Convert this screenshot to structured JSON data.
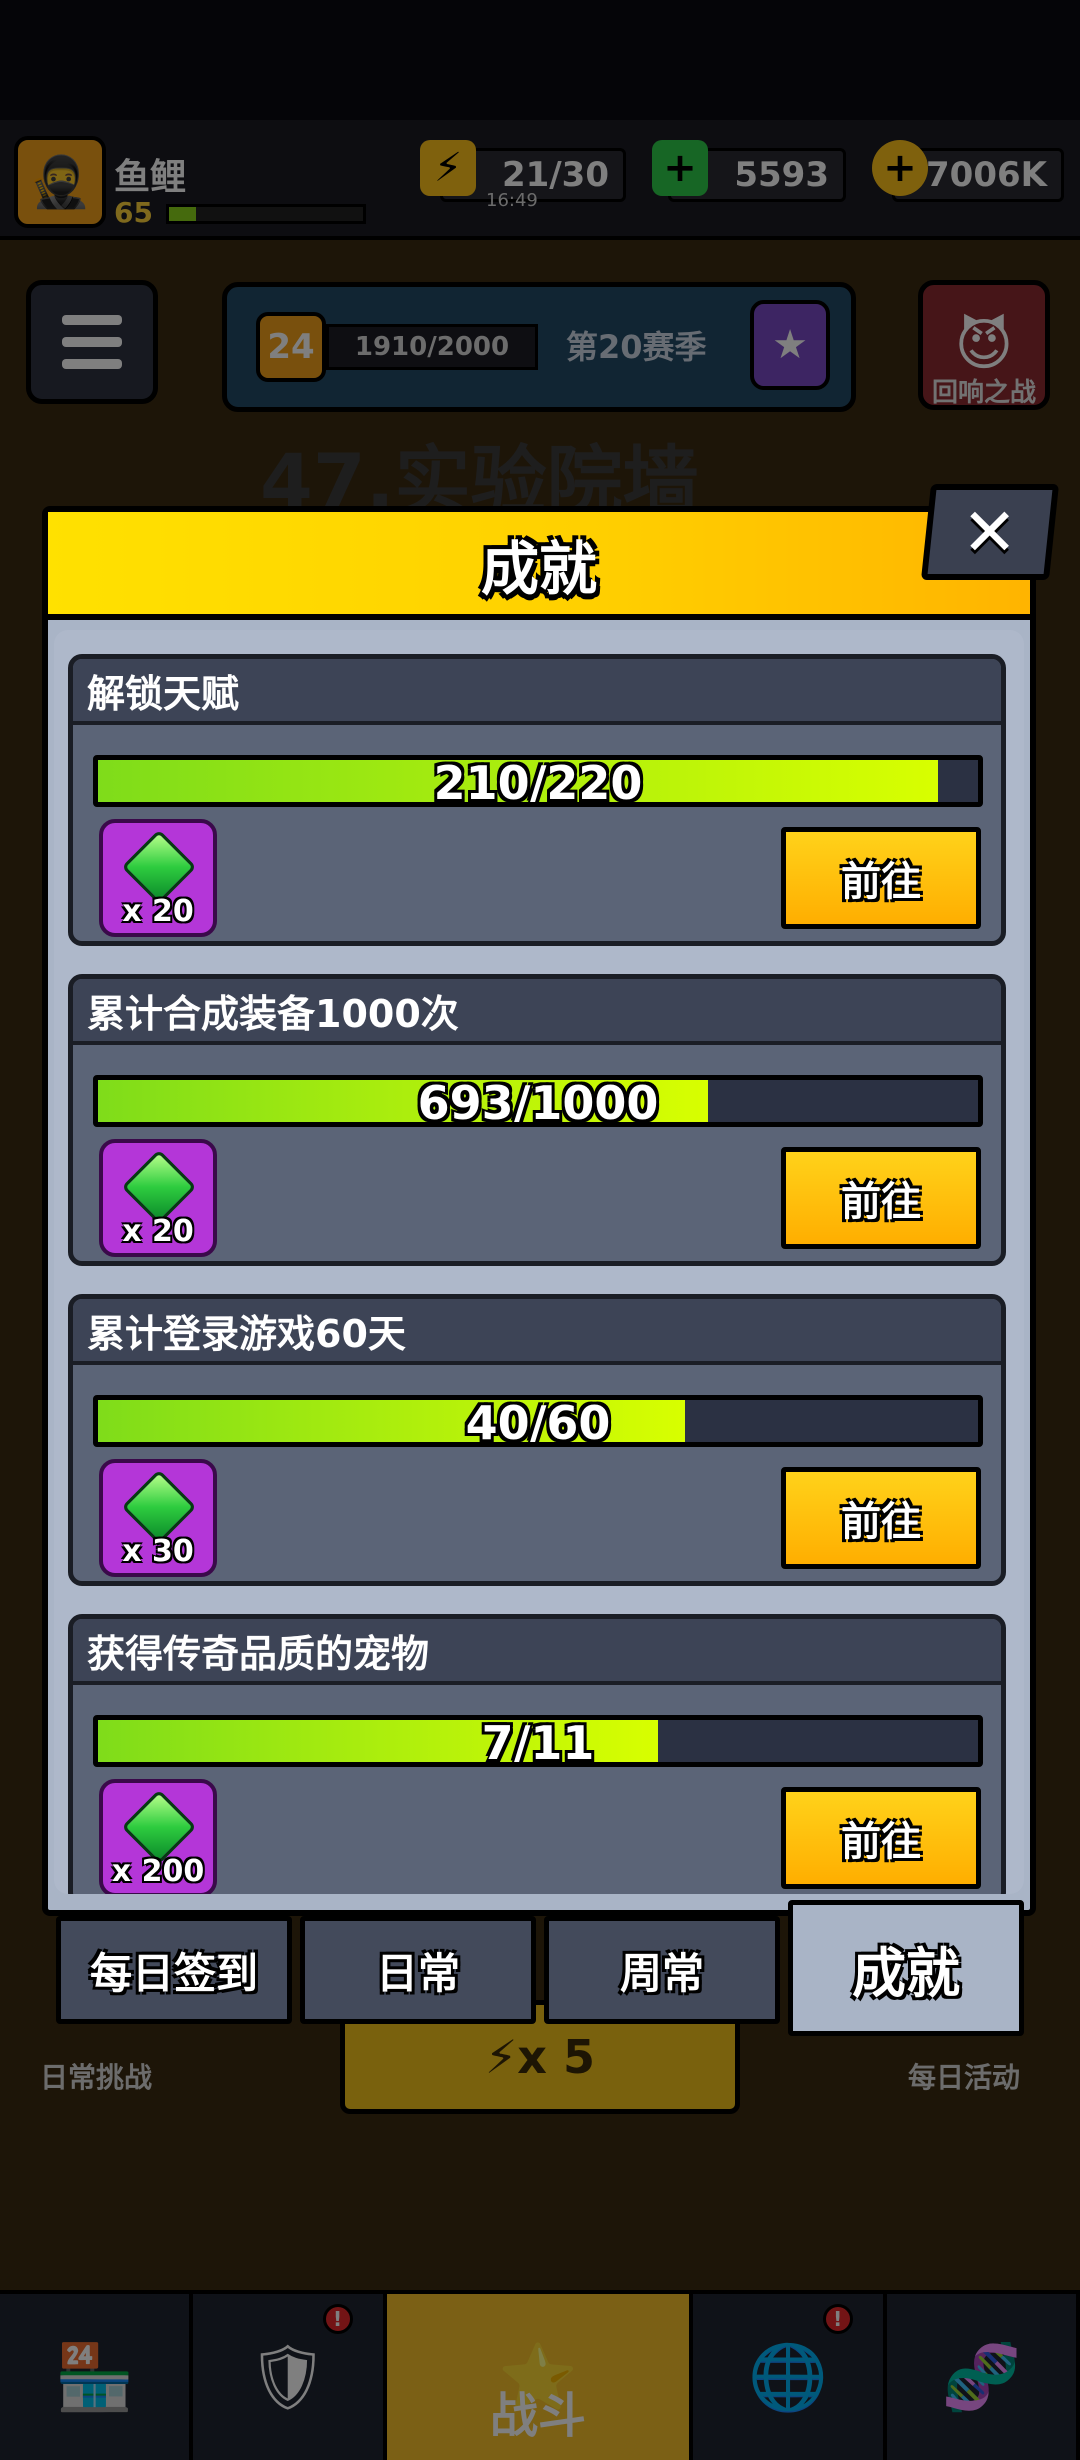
{
  "background": {
    "player": {
      "name": "鱼鲤",
      "level": "65",
      "level_progress": 0.14
    },
    "resources": {
      "energy": "21/30",
      "energy_timer": "16:49",
      "gems": "5593",
      "coins": "7006K"
    },
    "season": {
      "level": "24",
      "progress": "1910/2000",
      "name": "第20赛季"
    },
    "echo_battle_label": "回响之战",
    "level_title": "47.实验院墙",
    "daily_challenge_label": "日常挑战",
    "daily_activity_label": "每日活动",
    "energy_cost": "x 5",
    "bottom_nav": {
      "battle_label": "战斗",
      "badge": "!"
    }
  },
  "modal": {
    "title": "成就",
    "close_label": "✕",
    "achievements": [
      {
        "title": "解锁天赋",
        "progress_text": "210/220",
        "progress": 0.955,
        "reward_qty": "x 20",
        "button": "前往"
      },
      {
        "title": "累计合成装备1000次",
        "progress_text": "693/1000",
        "progress": 0.693,
        "reward_qty": "x 20",
        "button": "前往"
      },
      {
        "title": "累计登录游戏60天",
        "progress_text": "40/60",
        "progress": 0.667,
        "reward_qty": "x 30",
        "button": "前往"
      },
      {
        "title": "获得传奇品质的宠物",
        "progress_text": "7/11",
        "progress": 0.636,
        "reward_qty": "x 200",
        "button": "前往"
      }
    ],
    "tabs": [
      {
        "label": "每日签到",
        "active": false
      },
      {
        "label": "日常",
        "active": false
      },
      {
        "label": "周常",
        "active": false
      },
      {
        "label": "成就",
        "active": true
      }
    ]
  },
  "colors": {
    "header_yellow": "#ffd000",
    "progress_green": "#9be51a",
    "button_orange": "#ffb800",
    "reward_purple": "#b436d8"
  }
}
